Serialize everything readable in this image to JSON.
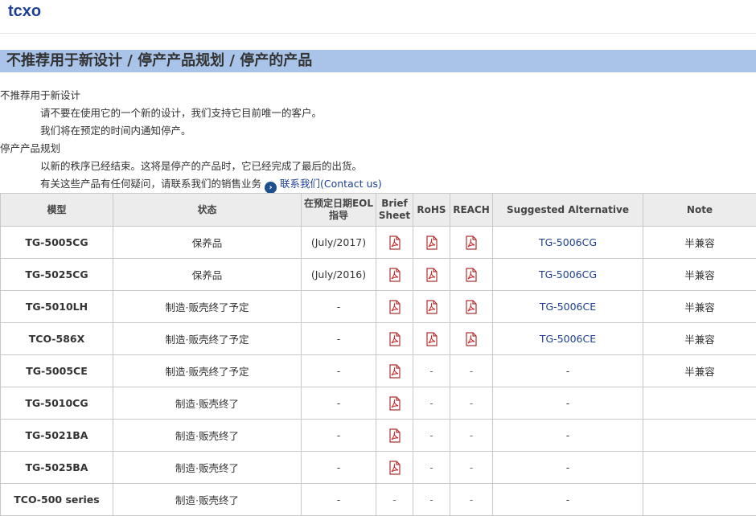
{
  "site": {
    "title": "tcxo"
  },
  "section": {
    "heading": "不推荐用于新设计 / 停产产品规划 / 停产的产品"
  },
  "notes": {
    "not_recommended_title": "不推荐用于新设计",
    "not_recommended_line1": "请不要在使用它的一个新的设计，我们支持它目前唯一的客户。",
    "not_recommended_line2": "我们将在预定的时间内通知停产。",
    "discontinued_title": "停产产品规划",
    "discontinued_line1": "以新的秩序已经结束。这将是停产的产品时，它已经完成了最后的出货。",
    "contact_prefix": "有关这些产品有任何疑问，请联系我们的销售业务",
    "contact_link": "联系我们(Contact us)"
  },
  "table": {
    "headers": {
      "model": "模型",
      "status": "状态",
      "eol": "在预定日期EOL指导",
      "brief": "Brief Sheet",
      "rohs": "RoHS",
      "reach": "REACH",
      "alternative": "Suggested Alternative",
      "note": "Note"
    },
    "rows": [
      {
        "model": "TG-5005CG",
        "status": "保养品",
        "eol": "(July/2017)",
        "brief": true,
        "rohs": true,
        "reach": true,
        "alternative": "TG-5006CG",
        "note": "半兼容"
      },
      {
        "model": "TG-5025CG",
        "status": "保养品",
        "eol": "(July/2016)",
        "brief": true,
        "rohs": true,
        "reach": true,
        "alternative": "TG-5006CG",
        "note": "半兼容"
      },
      {
        "model": "TG-5010LH",
        "status": "制造·贩壳终了予定",
        "eol": "-",
        "brief": true,
        "rohs": true,
        "reach": true,
        "alternative": "TG-5006CE",
        "note": "半兼容"
      },
      {
        "model": "TCO-586X",
        "status": "制造·贩壳终了予定",
        "eol": "-",
        "brief": true,
        "rohs": true,
        "reach": true,
        "alternative": "TG-5006CE",
        "note": "半兼容"
      },
      {
        "model": "TG-5005CE",
        "status": "制造·贩壳终了予定",
        "eol": "-",
        "brief": true,
        "rohs": false,
        "reach": false,
        "alternative": "-",
        "note": "半兼容"
      },
      {
        "model": "TG-5010CG",
        "status": "制造·贩壳终了",
        "eol": "-",
        "brief": true,
        "rohs": false,
        "reach": false,
        "alternative": "-",
        "note": ""
      },
      {
        "model": "TG-5021BA",
        "status": "制造·贩壳终了",
        "eol": "-",
        "brief": true,
        "rohs": false,
        "reach": false,
        "alternative": "-",
        "note": ""
      },
      {
        "model": "TG-5025BA",
        "status": "制造·贩壳终了",
        "eol": "-",
        "brief": true,
        "rohs": false,
        "reach": false,
        "alternative": "-",
        "note": ""
      },
      {
        "model": "TCO-500 series",
        "status": "制造·贩壳终了",
        "eol": "-",
        "brief": false,
        "rohs": false,
        "reach": false,
        "alternative": "-",
        "note": ""
      }
    ],
    "empty_cell": "-"
  },
  "colors": {
    "brand": "#1d3f93",
    "section_bar": "#a9c4e8",
    "header_bg": "#ececec",
    "pdf_red": "#cc2222"
  }
}
